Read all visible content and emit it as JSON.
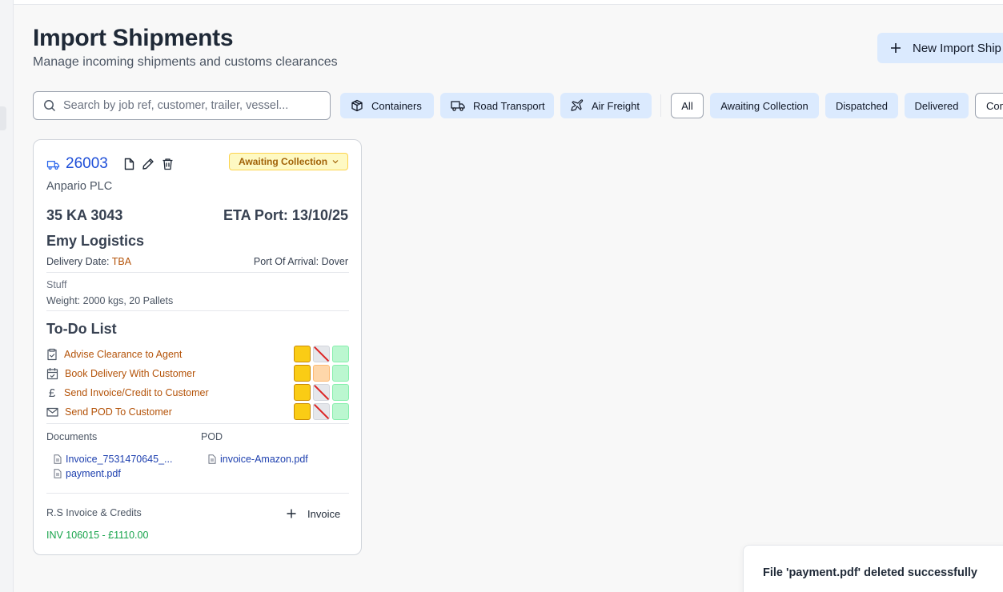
{
  "header": {
    "title": "Import Shipments",
    "subtitle": "Manage incoming shipments and customs clearances",
    "new_button": "New Import Ship"
  },
  "search": {
    "placeholder": "Search by job ref, customer, trailer, vessel..."
  },
  "type_filters": [
    {
      "label": "Containers",
      "icon": "box-icon"
    },
    {
      "label": "Road Transport",
      "icon": "truck-icon"
    },
    {
      "label": "Air Freight",
      "icon": "plane-icon"
    }
  ],
  "status_filters": [
    "All",
    "Awaiting Collection",
    "Dispatched",
    "Delivered",
    "Com"
  ],
  "card": {
    "job_ref": "26003",
    "status": "Awaiting Collection",
    "customer": "Anpario PLC",
    "trailer": "35 KA 3043",
    "eta": "ETA Port: 13/10/25",
    "haulier": "Emy Logistics",
    "delivery_label": "Delivery Date:",
    "delivery_value": "TBA",
    "port_label": "Port Of Arrival:",
    "port_value": "Dover",
    "goods": "Stuff",
    "weight": "Weight: 2000 kgs, 20 Pallets",
    "todo_title": "To-Do List",
    "todos": [
      {
        "label": "Advise Clearance to Agent",
        "icon": "clipboard-check-icon",
        "states": [
          "yellow",
          "disabled",
          "green"
        ]
      },
      {
        "label": "Book Delivery With Customer",
        "icon": "calendar-check-icon",
        "states": [
          "yellow",
          "orange",
          "green"
        ]
      },
      {
        "label": "Send Invoice/Credit to Customer",
        "icon": "pound-icon",
        "states": [
          "yellow",
          "disabled",
          "green"
        ]
      },
      {
        "label": "Send POD To Customer",
        "icon": "mail-icon",
        "states": [
          "yellow",
          "disabled",
          "green"
        ]
      }
    ],
    "documents_label": "Documents",
    "documents": [
      "Invoice_7531470645_...",
      "payment.pdf"
    ],
    "pod_label": "POD",
    "pod_files": [
      "invoice-Amazon.pdf"
    ],
    "invoices_label": "R.S Invoice & Credits",
    "add_invoice_label": "Invoice",
    "invoice_entry": "INV 106015 - £1110.00"
  },
  "toast": {
    "message": "File 'payment.pdf' deleted successfully"
  },
  "colors": {
    "accent_blue": "#dbeafe",
    "link_blue": "#1d4ed8",
    "todo_text": "#b45309",
    "status_yellow": "#facc15",
    "status_green": "#bbf7d0",
    "status_orange": "#fed7aa",
    "invoice_green": "#16a34a"
  }
}
